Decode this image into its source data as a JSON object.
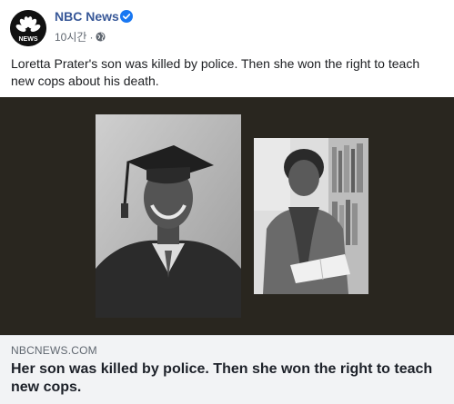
{
  "post": {
    "page_name": "NBC News",
    "timestamp": "10시간",
    "separator": "·",
    "body_text": "Loretta Prater's son was killed by police. Then she won the right to teach new cops about his death."
  },
  "logo": {
    "label": "NEWS"
  },
  "link_preview": {
    "domain": "NBCNEWS.COM",
    "title": "Her son was killed by police. Then she won the right to teach new cops."
  },
  "colors": {
    "page_name": "#385898",
    "verified_badge": "#1877f2",
    "media_background": "#29261f",
    "link_box_background": "#f2f3f5"
  },
  "icons": [
    "nbc-peacock-logo",
    "verified-badge-icon",
    "globe-icon"
  ]
}
